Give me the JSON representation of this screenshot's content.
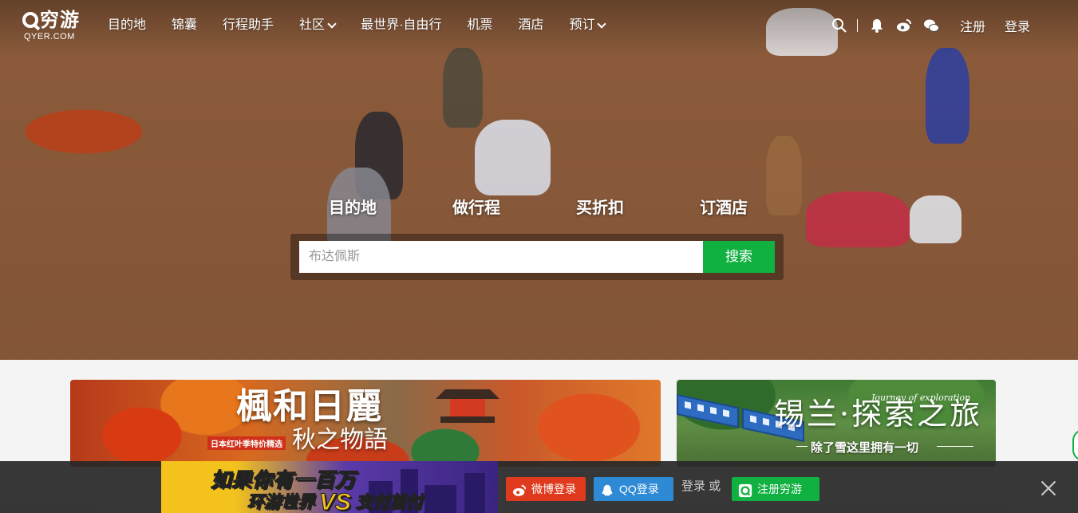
{
  "logo": {
    "brand": "穷游",
    "domain": "QYER.COM"
  },
  "nav": {
    "items": [
      {
        "label": "目的地",
        "dropdown": false
      },
      {
        "label": "锦囊",
        "dropdown": false
      },
      {
        "label": "行程助手",
        "dropdown": false
      },
      {
        "label": "社区",
        "dropdown": true
      },
      {
        "label": "最世界·自由行",
        "dropdown": false
      },
      {
        "label": "机票",
        "dropdown": false
      },
      {
        "label": "酒店",
        "dropdown": false
      },
      {
        "label": "预订",
        "dropdown": true
      }
    ],
    "icons": [
      "search-icon",
      "bell-icon",
      "weibo-icon",
      "wechat-icon"
    ],
    "register": "注册",
    "login": "登录"
  },
  "search": {
    "tabs": [
      "目的地",
      "做行程",
      "买折扣",
      "订酒店"
    ],
    "placeholder": "布达佩斯",
    "button": "搜索"
  },
  "banners": {
    "left": {
      "title": "楓和日麗",
      "subtitle": "秋之物語",
      "tag": "日本红叶季特价精选"
    },
    "right": {
      "title": "锡兰·探索之旅",
      "english": "Journey of exploration",
      "slogan": "除了雪这里拥有一切"
    }
  },
  "login_bar": {
    "ad_line1": "如果你有一百万",
    "ad_line2a": "环游世界",
    "ad_vs": "VS",
    "ad_line2b": "支付首付",
    "weibo_login": "微博登录",
    "qq_login": "QQ登录",
    "or_text": "登录 或",
    "register": "注册穷游"
  },
  "colors": {
    "accent_green": "#10b041",
    "weibo_red": "#e03a1e",
    "qq_blue": "#2f8ad6"
  }
}
